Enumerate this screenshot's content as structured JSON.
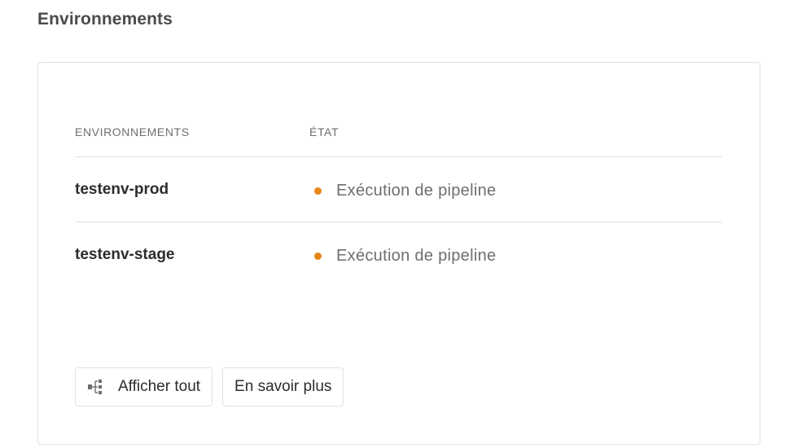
{
  "section": {
    "title": "Environnements"
  },
  "table": {
    "headers": {
      "environment": "ENVIRONNEMENTS",
      "state": "ÉTAT"
    },
    "rows": [
      {
        "name": "testenv-prod",
        "state": "Exécution de pipeline",
        "status_color": "#e68619"
      },
      {
        "name": "testenv-stage",
        "state": "Exécution de pipeline",
        "status_color": "#e68619"
      }
    ]
  },
  "buttons": {
    "show_all": {
      "label": "Afficher tout",
      "icon": "tree-view-icon"
    },
    "learn_more": {
      "label": "En savoir plus"
    }
  }
}
